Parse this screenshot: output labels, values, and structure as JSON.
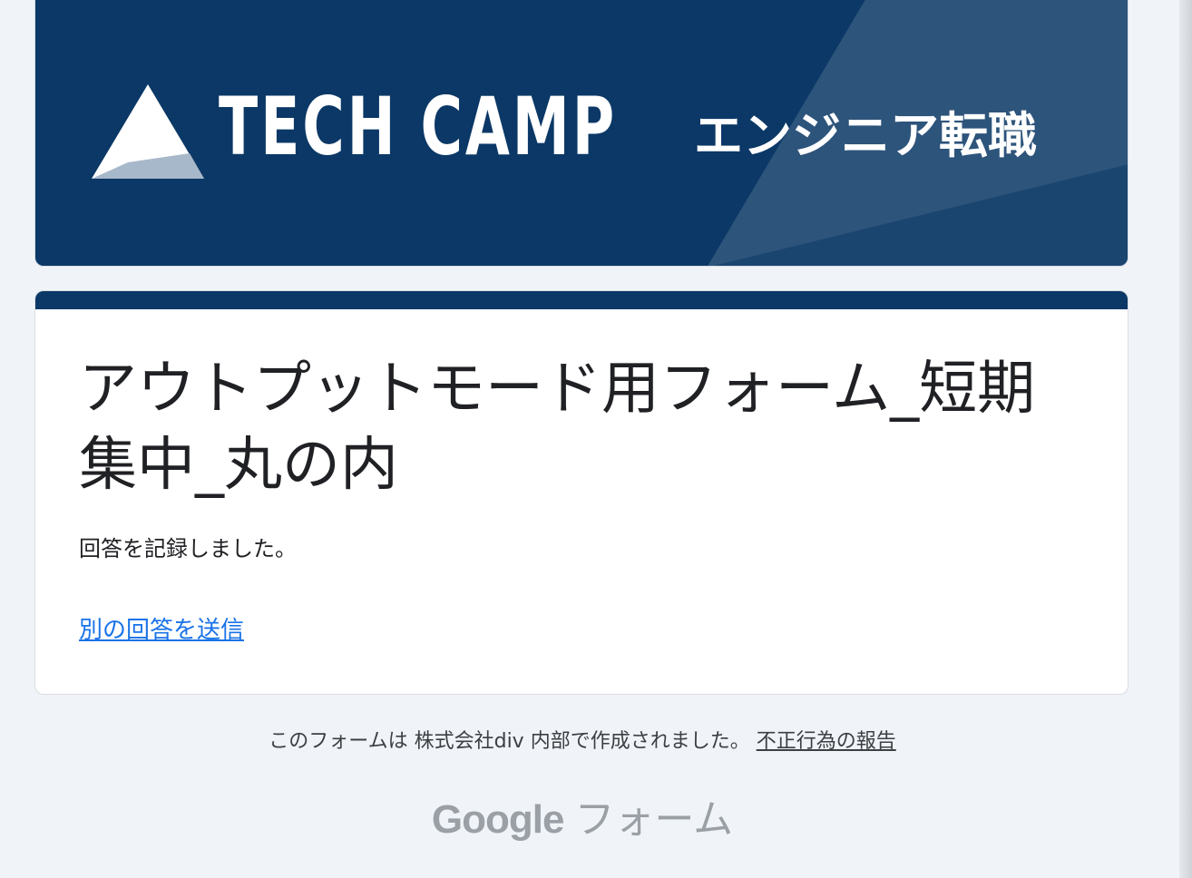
{
  "header": {
    "brand_name": "TECH CAMP",
    "brand_sub": "エンジニア転職",
    "colors": {
      "banner": "#0b3866"
    }
  },
  "form": {
    "title": "アウトプットモード用フォーム_短期集中_丸の内",
    "confirmation": "回答を記録しました。",
    "another_response_link": "別の回答を送信"
  },
  "footer": {
    "created_by": "このフォームは 株式会社div 内部で作成されました。",
    "report_link": "不正行為の報告",
    "logo_google": "Google",
    "logo_forms": "フォーム"
  }
}
